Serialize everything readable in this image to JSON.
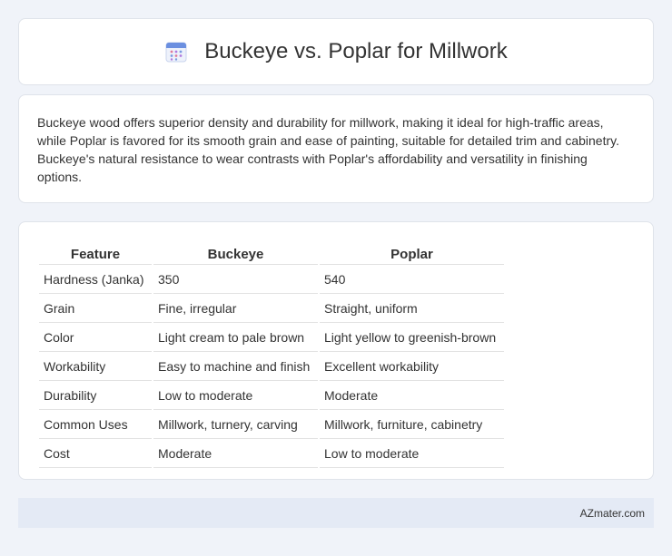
{
  "header": {
    "title": "Buckeye vs. Poplar for Millwork",
    "icon": "calendar-icon"
  },
  "description": {
    "text": "Buckeye wood offers superior density and durability for millwork, making it ideal for high-traffic areas, while Poplar is favored for its smooth grain and ease of painting, suitable for detailed trim and cabinetry. Buckeye's natural resistance to wear contrasts with Poplar's affordability and versatility in finishing options."
  },
  "table": {
    "headers": [
      "Feature",
      "Buckeye",
      "Poplar"
    ],
    "rows": [
      [
        "Hardness (Janka)",
        "350",
        "540"
      ],
      [
        "Grain",
        "Fine, irregular",
        "Straight, uniform"
      ],
      [
        "Color",
        "Light cream to pale brown",
        "Light yellow to greenish-brown"
      ],
      [
        "Workability",
        "Easy to machine and finish",
        "Excellent workability"
      ],
      [
        "Durability",
        "Low to moderate",
        "Moderate"
      ],
      [
        "Common Uses",
        "Millwork, turnery, carving",
        "Millwork, furniture, cabinetry"
      ],
      [
        "Cost",
        "Moderate",
        "Low to moderate"
      ]
    ]
  },
  "footer": {
    "site": "AZmater.com"
  },
  "colors": {
    "background": "#f0f3f9",
    "card": "#ffffff",
    "footer": "#e4eaf5",
    "icon_accent": "#6b8fe0"
  }
}
